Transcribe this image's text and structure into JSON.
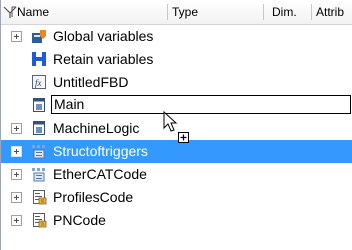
{
  "columns": [
    {
      "label": "Name"
    },
    {
      "label": "Type"
    },
    {
      "label": "Dim."
    },
    {
      "label": "Attrib"
    }
  ],
  "tree": [
    {
      "label": "Global variables",
      "icon": "global-variables-icon",
      "expandable": true
    },
    {
      "label": "Retain variables",
      "icon": "retain-variables-icon",
      "expandable": false
    },
    {
      "label": "UntitledFBD",
      "icon": "fbd-program-icon",
      "expandable": false
    },
    {
      "label": "Main",
      "icon": "program-icon",
      "expandable": false,
      "editing": true
    },
    {
      "label": "MachineLogic",
      "icon": "program-icon",
      "expandable": true
    },
    {
      "label": "Structoftriggers",
      "icon": "struct-icon",
      "expandable": true,
      "selected": true
    },
    {
      "label": "EtherCATCode",
      "icon": "struct-icon",
      "expandable": true
    },
    {
      "label": "ProfilesCode",
      "icon": "code-icon",
      "expandable": true
    },
    {
      "label": "PNCode",
      "icon": "code-icon",
      "expandable": true
    }
  ],
  "colors": {
    "selection": "#3399ff",
    "header": "#f1f1f1"
  }
}
